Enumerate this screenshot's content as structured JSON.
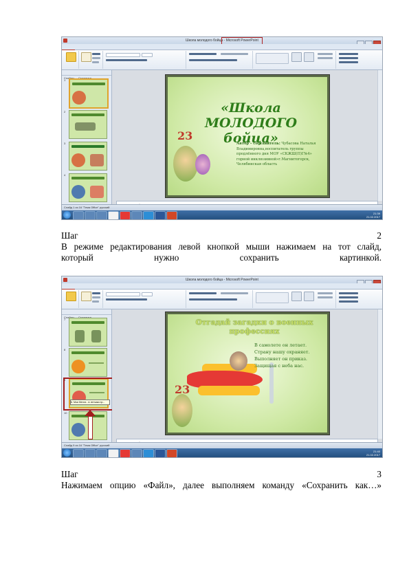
{
  "screenshot1": {
    "window_title_left": "Школа молодого бойца - ",
    "window_title_right": "Microsoft PowerPoint",
    "tabs": [
      "Файл",
      "Главная",
      "Вставка",
      "Дизайн",
      "Переходы",
      "Анимация",
      "Показ слайдов",
      "Рецензирование",
      "Вид"
    ],
    "sidebar_tabs": [
      "Слайды",
      "Структура"
    ],
    "slide_numbers": [
      "1",
      "2",
      "3",
      "4"
    ],
    "notes_placeholder": "Заметки к слайду",
    "slide": {
      "title": "«Школа МОЛОДОГО бойца»",
      "logo_number": "23",
      "author_label": "Автор – составитель:",
      "author_text": "Чубасова Наталья Владимировна,воспитатель группы продлённого дня МОУ «СОКШ(П)Г№4» (горной инклюзивной) Магнитогорская область",
      "author_text_full": "Чубасова Наталья Владимировна,воспитатель группы продлённого дня МОУ «СКЖШ(П)Г№4» горной инклюзивной»г.Магнитогорск, Челябинская область"
    },
    "status": "Слайд 1 из 16   \"Тема Office\"   русский",
    "clock_time": "21:39",
    "clock_date": "21.02.2017"
  },
  "step2": {
    "label": "Шаг",
    "number": "2",
    "text_line1": "В режиме редактирования левой кнопкой мыши нажимаем на тот слайд,",
    "text_line2": "который нужно сохранить картинкой."
  },
  "screenshot2": {
    "window_title": "Школа молодого бойца - Microsoft PowerPoint",
    "tabs": [
      "Файл",
      "Главная",
      "Вставка",
      "Дизайн",
      "Переходы",
      "Анимация",
      "Показ слайдов",
      "Рецензирование",
      "Вид"
    ],
    "sidebar_tabs": [
      "Слайды",
      "Структура"
    ],
    "slide_numbers": [
      "7",
      "8",
      "9",
      "10"
    ],
    "notes_placeholder": "Заметки к слайду",
    "tooltip": "6. Моя Мечта - в летчики пр...",
    "slide": {
      "title_line1": "Отгадай загадки о военных",
      "title_line2": "профессиях",
      "logo_number": "23",
      "riddle": [
        "В самолете он летает.",
        "Страну нашу охраняет.",
        "Выполняет он приказ.",
        "Защищая с неба нас."
      ]
    },
    "status": "Слайд 9 из 16   \"Тема Office\"   русский",
    "clock_time": "21:40",
    "clock_date": "21.02.2017"
  },
  "step3": {
    "label": "Шаг",
    "number": "3",
    "text_line1": "Нажимаем опцию «Файл», далее выполняем команду «Сохранить как…»"
  },
  "colors": {
    "slide_green": "#cfe9a5",
    "title_green": "#2e7d1a",
    "highlight_red": "#a31d1d",
    "file_tab_red": "#c0392b"
  }
}
